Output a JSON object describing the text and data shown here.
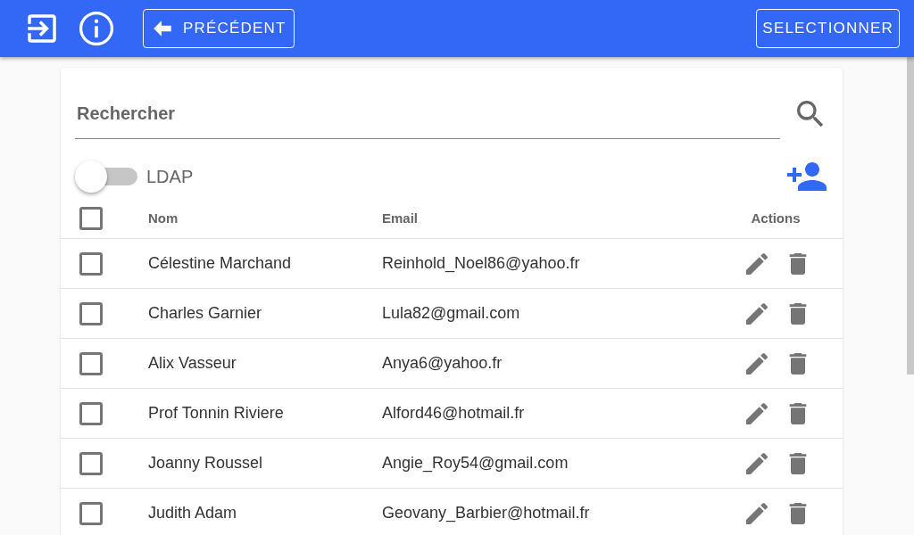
{
  "toolbar": {
    "back_label": "PRÉCÉDENT",
    "select_label": "SELECTIONNER"
  },
  "search": {
    "placeholder": "Rechercher"
  },
  "ldap": {
    "label": "LDAP",
    "on": false
  },
  "table": {
    "columns": [
      "Nom",
      "Email",
      "Actions"
    ],
    "all_checked": false,
    "rows": [
      {
        "name": "Célestine Marchand",
        "email": "Reinhold_Noel86@yahoo.fr",
        "checked": false
      },
      {
        "name": "Charles Garnier",
        "email": "Lula82@gmail.com",
        "checked": false
      },
      {
        "name": "Alix Vasseur",
        "email": "Anya6@yahoo.fr",
        "checked": false
      },
      {
        "name": "Prof Tonnin Riviere",
        "email": "Alford46@hotmail.fr",
        "checked": false
      },
      {
        "name": "Joanny Roussel",
        "email": "Angie_Roy54@gmail.com",
        "checked": false
      },
      {
        "name": "Judith Adam",
        "email": "Geovany_Barbier@hotmail.fr",
        "checked": false
      }
    ]
  }
}
